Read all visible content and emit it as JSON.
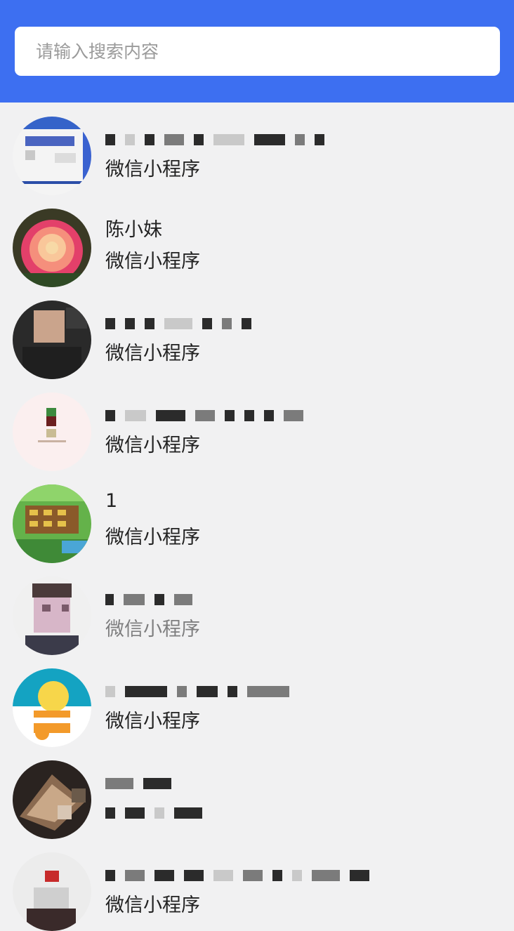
{
  "search": {
    "placeholder": "请输入搜索内容"
  },
  "items": [
    {
      "name": "",
      "subtitle": "微信小程序",
      "avatar": "blurred-document-avatar"
    },
    {
      "name": "陈小妹",
      "subtitle": "微信小程序",
      "avatar": "rose-avatar"
    },
    {
      "name": "",
      "subtitle": "微信小程序",
      "avatar": "person-avatar"
    },
    {
      "name": "",
      "subtitle": "微信小程序",
      "avatar": "logo-avatar"
    },
    {
      "name": "1",
      "subtitle": "微信小程序",
      "avatar": "farm-game-avatar"
    },
    {
      "name": "",
      "subtitle": "微信小程序",
      "avatar": "portrait-avatar"
    },
    {
      "name": "",
      "subtitle": "微信小程序",
      "avatar": "cartoon-avatar"
    },
    {
      "name": "",
      "subtitle": "",
      "avatar": "book-avatar"
    },
    {
      "name": "",
      "subtitle": "微信小程序",
      "avatar": "blurred-avatar"
    }
  ]
}
